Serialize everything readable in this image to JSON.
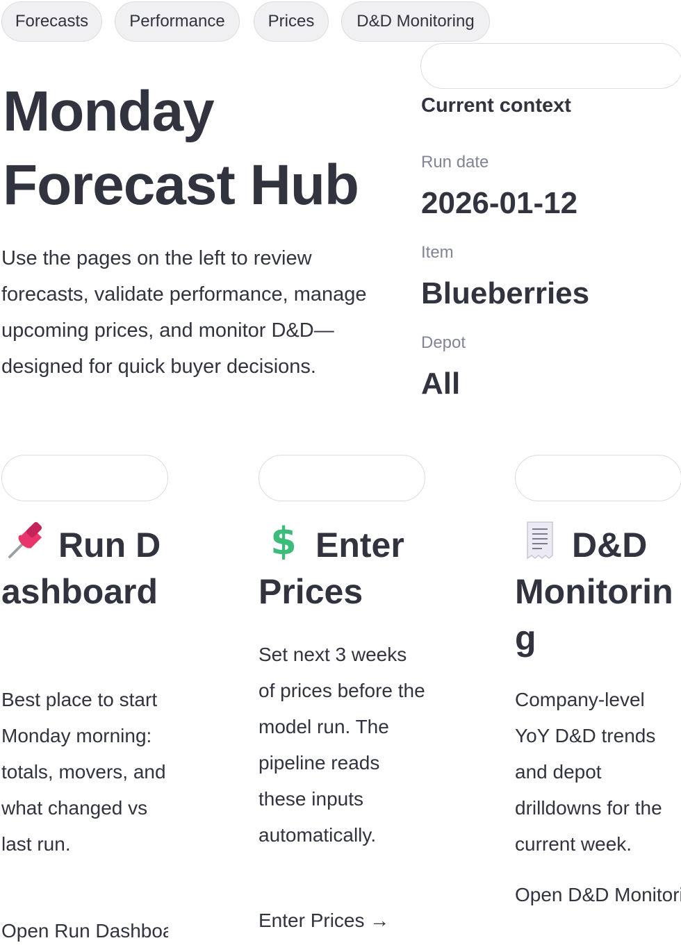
{
  "nav": {
    "pills": [
      "Forecasts",
      "Performance",
      "Prices",
      "D&D Monitoring"
    ]
  },
  "hero": {
    "title": "Monday Forecast Hub",
    "description": "Use the pages on the left to review forecasts, validate performance, manage upcoming prices, and monitor D&D—designed for quick buyer decisions."
  },
  "context": {
    "heading": "Current context",
    "run_date_label": "Run date",
    "run_date": "2026-01-12",
    "item_label": "Item",
    "item": "Blueberries",
    "depot_label": "Depot",
    "depot": "All"
  },
  "cards": [
    {
      "icon": "pushpin-icon",
      "title": "Run Dashboard",
      "description": "Best place to start Monday morning: totals, movers, and what changed vs last run.",
      "link": "Open Run Dashboard →"
    },
    {
      "icon": "dollar-icon",
      "title": "Enter Prices",
      "description": "Set next 3 weeks of prices before the model run. The pipeline reads these inputs automatically.",
      "link": "Enter Prices →"
    },
    {
      "icon": "receipt-icon",
      "title": "D&D Monitoring",
      "description": "Company-level YoY D&D trends and depot drilldowns for the current week.",
      "link": "Open D&D Monitoring →"
    }
  ],
  "colors": {
    "text": "#31333f",
    "muted": "#808495",
    "pill_bg": "#f0f0f2",
    "border": "#dcdcde",
    "pin": "#e8356b",
    "dollar": "#3dbb7a"
  }
}
